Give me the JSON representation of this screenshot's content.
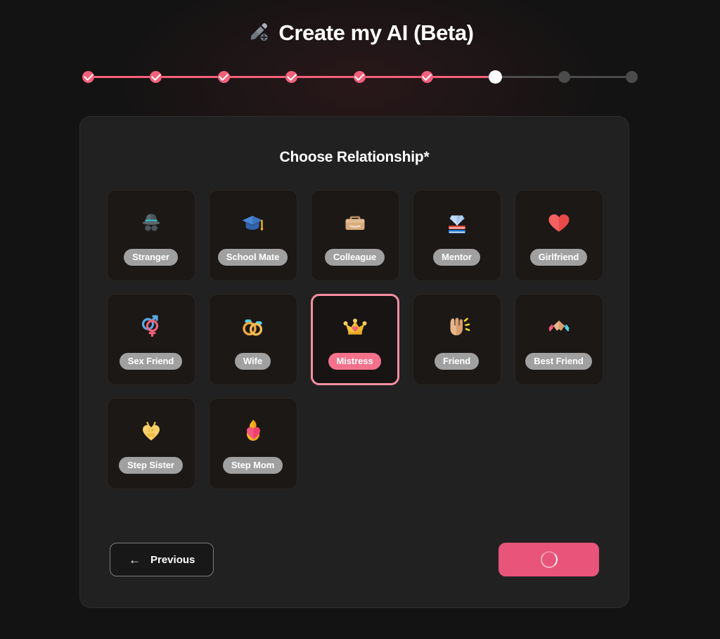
{
  "header": {
    "icon": "pencil-add-icon",
    "title": "Create my AI (Beta)"
  },
  "stepper": {
    "total_steps": 9,
    "current_step": 7,
    "completed": 6,
    "states": [
      "done",
      "done",
      "done",
      "done",
      "done",
      "done",
      "active",
      "todo",
      "todo"
    ],
    "colors": {
      "done": "#f4607a",
      "active": "#ffffff",
      "todo": "#4b4b4b"
    }
  },
  "panel": {
    "title": "Choose Relationship*",
    "selected_option": "Mistress",
    "options": [
      {
        "label": "Stranger",
        "icon": "detective-icon",
        "emoji": "🕵️",
        "selected": false
      },
      {
        "label": "School Mate",
        "icon": "graduation-cap-icon",
        "emoji": "🎓",
        "selected": false
      },
      {
        "label": "Colleague",
        "icon": "briefcase-icon",
        "emoji": "💼",
        "selected": false
      },
      {
        "label": "Mentor",
        "icon": "diamond-books-icon",
        "emoji": "💎",
        "selected": false
      },
      {
        "label": "Girlfriend",
        "icon": "red-heart-icon",
        "emoji": "❤️",
        "selected": false
      },
      {
        "label": "Sex Friend",
        "icon": "gender-symbols-icon",
        "emoji": "⚧",
        "selected": false
      },
      {
        "label": "Wife",
        "icon": "wedding-rings-icon",
        "emoji": "💍",
        "selected": false
      },
      {
        "label": "Mistress",
        "icon": "crown-icon",
        "emoji": "👑",
        "selected": true
      },
      {
        "label": "Friend",
        "icon": "raised-hand-icon",
        "emoji": "🖐️",
        "selected": false
      },
      {
        "label": "Best Friend",
        "icon": "handshake-icon",
        "emoji": "🤝",
        "selected": false
      },
      {
        "label": "Step Sister",
        "icon": "heart-locket-sis-icon",
        "emoji": "💛",
        "selected": false
      },
      {
        "label": "Step Mom",
        "icon": "heart-on-fire-icon",
        "emoji": "❤️‍🔥",
        "selected": false
      }
    ]
  },
  "footer": {
    "previous_label": "Previous",
    "previous_arrow": "←",
    "next_state": "loading",
    "next_label": ""
  },
  "colors": {
    "page_bg": "#131313",
    "panel_bg": "#212121",
    "option_bg": "#1c1816",
    "accent_pink": "#f4607a",
    "selected_border": "#f58fa3",
    "pill_gray": "#a0a0a0",
    "next_button": "#e8547a"
  }
}
